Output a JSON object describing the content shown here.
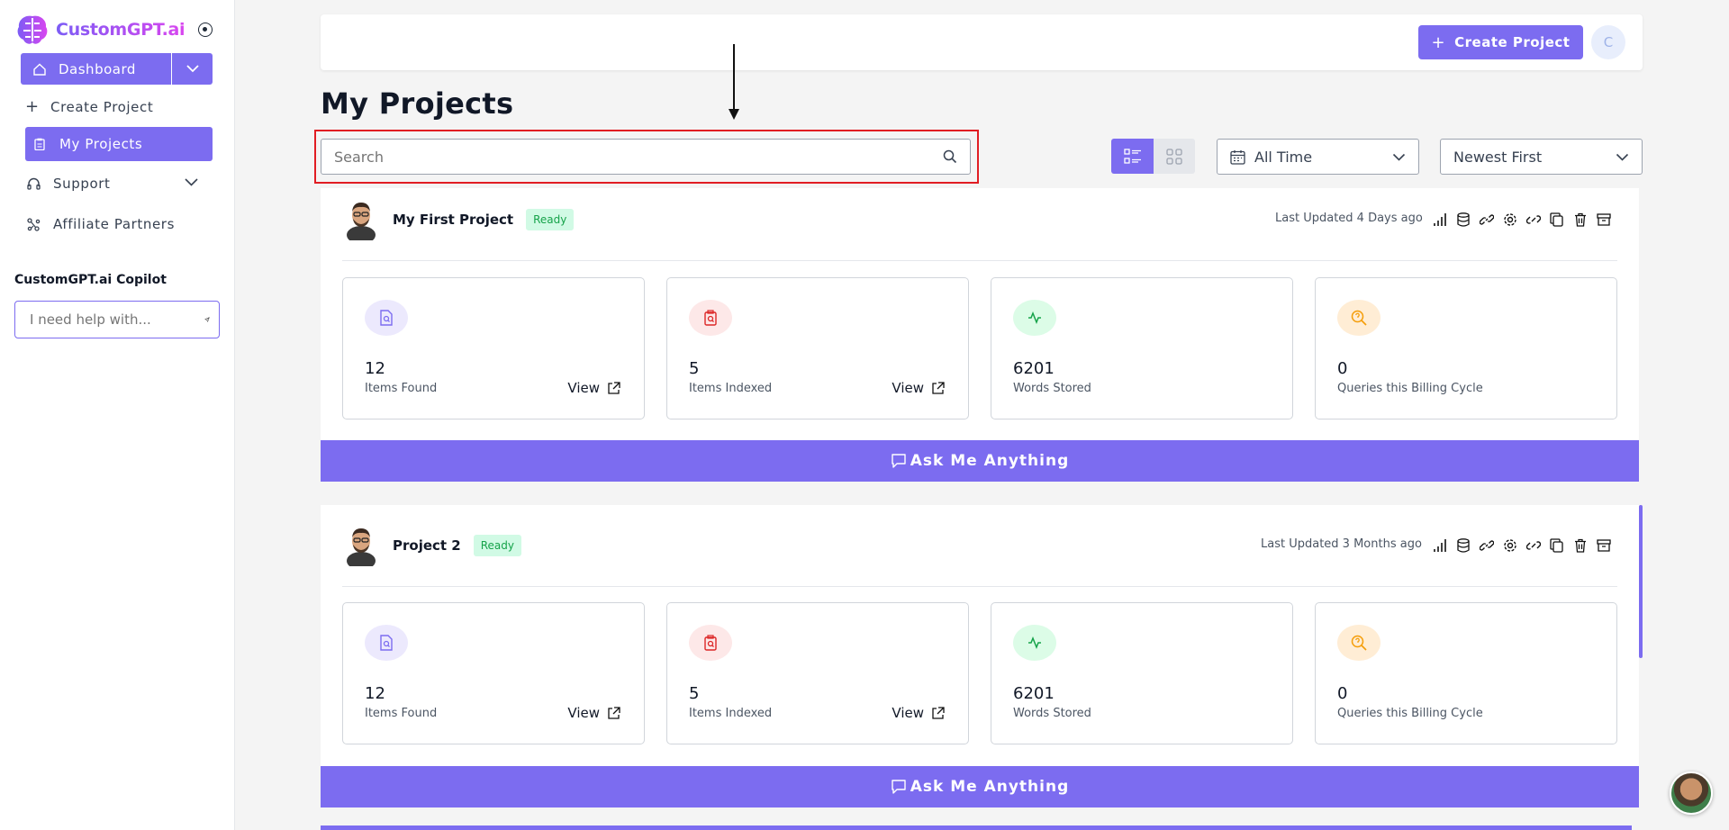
{
  "brand": {
    "name": "CustomGPT.ai"
  },
  "sidebar": {
    "dashboard_label": "Dashboard",
    "items": [
      {
        "label": "Create Project",
        "icon": "plus-icon"
      },
      {
        "label": "My Projects",
        "icon": "clipboard-icon",
        "active": true
      },
      {
        "label": "Support",
        "icon": "headphones-icon"
      },
      {
        "label": "Affiliate Partners",
        "icon": "network-icon"
      }
    ],
    "copilot": {
      "label": "CustomGPT.ai Copilot",
      "placeholder": "I need help with..."
    }
  },
  "header": {
    "create_label": "Create Project",
    "avatar_initial": "C"
  },
  "main": {
    "title": "My Projects",
    "search": {
      "placeholder": "Search"
    },
    "time_filter": "All Time",
    "sort": "Newest First"
  },
  "projects": [
    {
      "name": "My First Project",
      "status": "Ready",
      "updated": "Last Updated 4 Days ago",
      "stats": [
        {
          "value": "12",
          "label": "Items Found",
          "view": "View"
        },
        {
          "value": "5",
          "label": "Items Indexed",
          "view": "View"
        },
        {
          "value": "6201",
          "label": "Words Stored"
        },
        {
          "value": "0",
          "label": "Queries this Billing Cycle"
        }
      ],
      "ask_label": "Ask Me Anything"
    },
    {
      "name": "Project 2",
      "status": "Ready",
      "updated": "Last Updated 3 Months ago",
      "stats": [
        {
          "value": "12",
          "label": "Items Found",
          "view": "View"
        },
        {
          "value": "5",
          "label": "Items Indexed",
          "view": "View"
        },
        {
          "value": "6201",
          "label": "Words Stored"
        },
        {
          "value": "0",
          "label": "Queries this Billing Cycle"
        }
      ],
      "ask_label": "Ask Me Anything"
    }
  ],
  "colors": {
    "accent": "#7c6cf0",
    "ready_bg": "#d1fae5",
    "ready_text": "#16a34a",
    "highlight": "#e11d23"
  }
}
